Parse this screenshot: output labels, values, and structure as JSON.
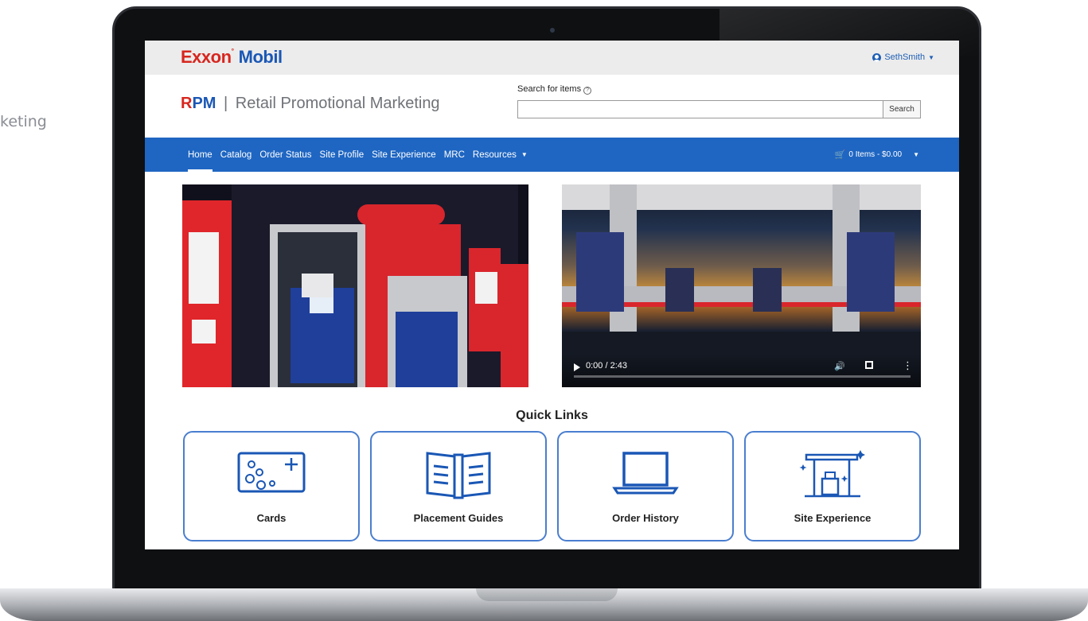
{
  "background_text": "keting",
  "app": {
    "logo_exxon": "Exxon",
    "logo_mobil": "Mobil",
    "user_name": "SethSmith"
  },
  "header": {
    "brand_r": "R",
    "brand_pm": "PM",
    "brand_sep": "|",
    "brand_name": "Retail Promotional Marketing",
    "search_label": "Search for items",
    "search_value": "",
    "search_button": "Search"
  },
  "nav": {
    "items": [
      {
        "label": "Home",
        "active": true
      },
      {
        "label": "Catalog"
      },
      {
        "label": "Order Status"
      },
      {
        "label": "Site Profile"
      },
      {
        "label": "Site Experience"
      },
      {
        "label": "MRC"
      },
      {
        "label": "Resources"
      }
    ],
    "cart_label": "0 Items - $0.00"
  },
  "video": {
    "time": "0:00 / 2:43",
    "progress": 0
  },
  "quick_links": {
    "title": "Quick Links",
    "items": [
      {
        "label": "Cards",
        "icon": "cards-icon"
      },
      {
        "label": "Placement Guides",
        "icon": "book-icon"
      },
      {
        "label": "Order History",
        "icon": "laptop-icon"
      },
      {
        "label": "Site Experience",
        "icon": "gas-station-icon"
      }
    ]
  },
  "colors": {
    "brand_red": "#d7261e",
    "brand_blue": "#1a57b5",
    "nav_blue": "#1f66c2",
    "card_border": "#4a7ecf"
  }
}
